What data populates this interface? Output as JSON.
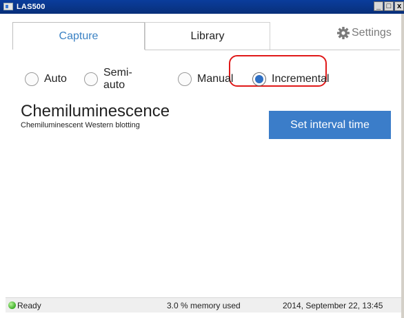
{
  "window": {
    "title": "LAS500",
    "min_label": "_",
    "max_label": "□",
    "close_label": "x"
  },
  "tabs": [
    {
      "label": "Capture",
      "active": true
    },
    {
      "label": "Library",
      "active": false
    }
  ],
  "settings": {
    "label": "Settings",
    "icon": "gear-icon"
  },
  "capture_modes": {
    "options": [
      {
        "label": "Auto",
        "selected": false
      },
      {
        "label": "Semi-auto",
        "selected": false
      },
      {
        "label": "Manual",
        "selected": false
      },
      {
        "label": "Incremental",
        "selected": true
      }
    ],
    "highlight_color": "#e01818"
  },
  "mode": {
    "title": "Chemiluminescence",
    "subtitle": "Chemiluminescent Western blotting"
  },
  "actions": {
    "interval_button_label": "Set interval time",
    "interval_button_color": "#3b7dc9"
  },
  "status": {
    "state": "Ready",
    "state_color": "#3fae2a",
    "memory": "3.0 % memory used",
    "datetime": "2014, September 22, 13:45"
  },
  "colors": {
    "accent": "#3b82c4",
    "radio_fill": "#2e6fc4"
  }
}
